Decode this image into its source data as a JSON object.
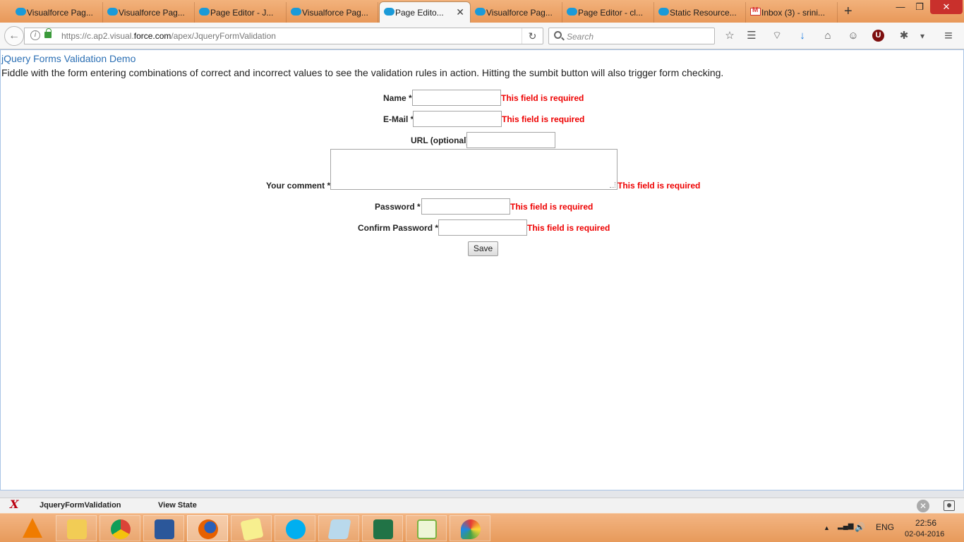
{
  "browser": {
    "tabs": [
      {
        "label": "Visualforce Pag...",
        "icon": "salesforce-cloud-icon"
      },
      {
        "label": "Visualforce Pag...",
        "icon": "salesforce-cloud-icon"
      },
      {
        "label": "Page Editor - J...",
        "icon": "salesforce-cloud-icon"
      },
      {
        "label": "Visualforce Pag...",
        "icon": "salesforce-cloud-icon"
      },
      {
        "label": "Page Edito...",
        "icon": "salesforce-cloud-icon",
        "active": true
      },
      {
        "label": "Visualforce Pag...",
        "icon": "salesforce-cloud-icon"
      },
      {
        "label": "Page Editor - cl...",
        "icon": "salesforce-cloud-icon"
      },
      {
        "label": "Static Resource...",
        "icon": "salesforce-cloud-icon"
      },
      {
        "label": "Inbox (3) - srini...",
        "icon": "gmail-icon"
      }
    ],
    "tab_close_glyph": "✕",
    "new_tab_glyph": "+",
    "window_controls": {
      "minimize": "—",
      "restore": "❐",
      "close": "✕"
    },
    "url": {
      "prefix": "https://c.ap2.visual.",
      "domain": "force.com",
      "path": "/apex/JqueryFormValidation"
    },
    "search_placeholder": "Search",
    "toolbar_glyphs": {
      "back": "←",
      "info": "i",
      "reload": "↻",
      "bookmark": "☆",
      "reading_list": "☰",
      "pocket": "⌔",
      "download": "↓",
      "home": "⌂",
      "hello": "☺",
      "ublock": "U",
      "extension": "✱",
      "dropdown": "▾",
      "menu": "≡"
    }
  },
  "page": {
    "title": "jQuery Forms Validation Demo",
    "description": "Fiddle with the form entering combinations of correct and incorrect values to see the validation rules in action. Hitting the sumbit button will also trigger form checking.",
    "form": {
      "name": {
        "label": "Name *",
        "value": "",
        "error": "This field is required"
      },
      "email": {
        "label": "E-Mail *",
        "value": "",
        "error": "This field is required"
      },
      "url": {
        "label": "URL (optional)",
        "value": ""
      },
      "comment": {
        "label": "Your comment *",
        "value": "",
        "error": "This field is required"
      },
      "password": {
        "label": "Password *",
        "value": "",
        "error": "This field is required"
      },
      "confirm_password": {
        "label": "Confirm Password *",
        "value": "",
        "error": "This field is required"
      },
      "save_label": "Save"
    }
  },
  "devbar": {
    "logo": "X",
    "page_name": "JqueryFormValidation",
    "view_state": "View State",
    "close_glyph": "✕"
  },
  "taskbar": {
    "apps": [
      "vlc-icon",
      "file-explorer-icon",
      "chrome-icon",
      "word-icon",
      "firefox-icon",
      "sticky-notes-icon",
      "skype-icon",
      "notepad-icon",
      "excel-icon",
      "notepadpp-icon",
      "paint-icon"
    ],
    "tray": {
      "arrow": "▲",
      "signal": "▂▄▆",
      "volume": "🔊",
      "language": "ENG"
    },
    "time": "22:56",
    "date": "02-04-2016"
  },
  "colors": {
    "link": "#2b6fb4",
    "error": "#e00000",
    "taskbar": "#e89a5b"
  }
}
